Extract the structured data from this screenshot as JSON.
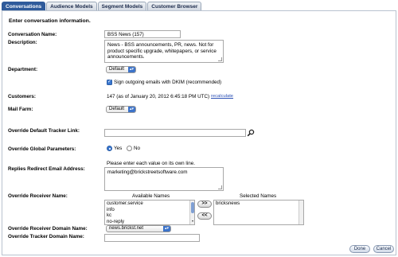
{
  "tabs": [
    "Conversations",
    "Audience Models",
    "Segment Models",
    "Customer Browser"
  ],
  "form": {
    "heading": "Enter conversation information.",
    "conversation_name_label": "Conversation Name:",
    "conversation_name_value": "BSS News (157)",
    "description_label": "Description:",
    "description_value": "News - BSS announcements, PR, news.  Not for product specific upgrade, whitepapers, or service announcements.",
    "department_label": "Department:",
    "department_value": "Default",
    "dkim_label": "Sign outgoing emails with DKIM (recommended)",
    "dkim_checked": true,
    "customers_label": "Customers:",
    "customers_value": "147 (as of January 20, 2012 6:45:18 PM UTC)",
    "recalculate_label": "recalculate",
    "mail_farm_label": "Mail Farm:",
    "mail_farm_value": "Default",
    "tracker_link_label": "Override Default Tracker Link:",
    "tracker_link_value": "",
    "global_params_label": "Override Global Parameters:",
    "global_params_yes": "Yes",
    "global_params_no": "No",
    "global_params_selected": "Yes",
    "replies_label": "Replies Redirect Email Address:",
    "replies_hint": "Please enter each value on its own line.",
    "replies_value": "marketing@brickstreetsoftware.com",
    "receiver_name_label": "Override Receiver Name:",
    "available_names_header": "Available Names",
    "selected_names_header": "Selected Names",
    "available_names": [
      "customer.service",
      "info",
      "kc",
      "no-reply"
    ],
    "selected_names": [
      "bricksnews"
    ],
    "add_button": ">>",
    "remove_button": "<<",
    "receiver_domain_label": "Override Receiver Domain Name:",
    "receiver_domain_value": "news.brickst.net",
    "tracker_domain_label": "Override Tracker Domain Name:",
    "tracker_domain_value": ""
  },
  "footer": {
    "done": "Done",
    "cancel": "Cancel"
  },
  "colors": {
    "active_tab": "#2f5b9b",
    "control_accent": "#3a78d0",
    "link": "#2a4fb5"
  }
}
